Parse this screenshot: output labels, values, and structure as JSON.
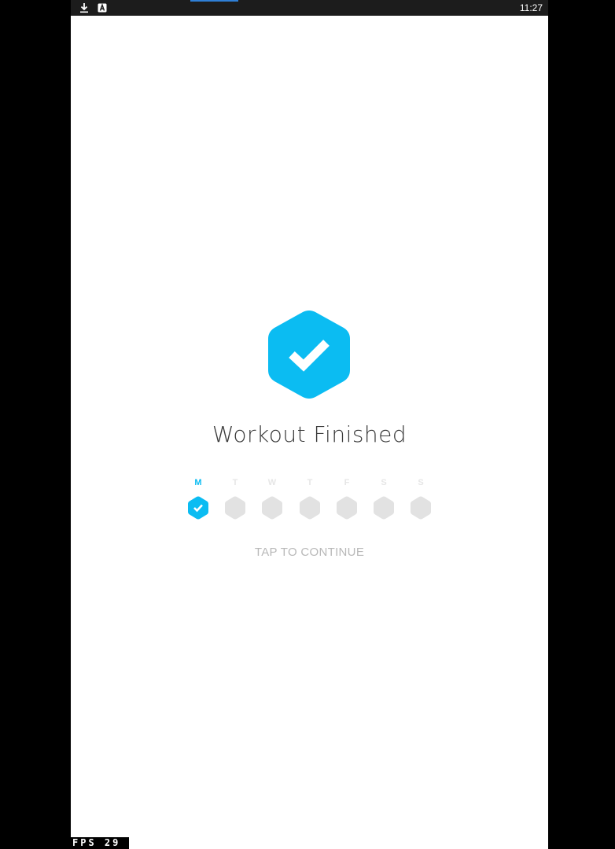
{
  "status_bar": {
    "time": "11:27",
    "icons": [
      "download-icon",
      "a-icon"
    ]
  },
  "workout": {
    "title": "Workout Finished",
    "continue_label": "TAP TO CONTINUE"
  },
  "week": {
    "days": [
      {
        "letter": "M",
        "completed": true
      },
      {
        "letter": "T",
        "completed": false
      },
      {
        "letter": "W",
        "completed": false
      },
      {
        "letter": "T",
        "completed": false
      },
      {
        "letter": "F",
        "completed": false
      },
      {
        "letter": "S",
        "completed": false
      },
      {
        "letter": "S",
        "completed": false
      }
    ]
  },
  "colors": {
    "accent": "#0bbcf2",
    "inactive_hex": "#e2e2e2",
    "title_text": "#3a3a3a",
    "muted_text": "#b8b8b8"
  },
  "debug": {
    "fps_label": "FPS",
    "fps_value": "29"
  }
}
